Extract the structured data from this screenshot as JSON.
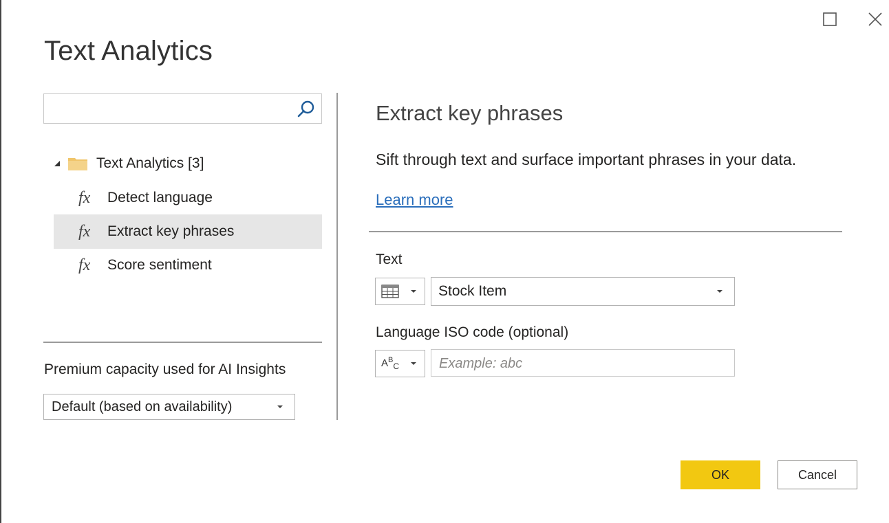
{
  "dialog": {
    "title": "Text Analytics"
  },
  "window_controls": {
    "maximize_icon": "maximize-icon",
    "close_icon": "close-icon"
  },
  "search": {
    "value": "",
    "placeholder": "",
    "icon": "search-icon"
  },
  "tree": {
    "root_label": "Text Analytics [3]",
    "root_expanded": true,
    "items": [
      {
        "label": "Detect language",
        "icon": "fx-icon",
        "selected": false
      },
      {
        "label": "Extract key phrases",
        "icon": "fx-icon",
        "selected": true
      },
      {
        "label": "Score sentiment",
        "icon": "fx-icon",
        "selected": false
      }
    ]
  },
  "premium": {
    "label": "Premium capacity used for AI Insights",
    "selected": "Default (based on availability)"
  },
  "function": {
    "title": "Extract key phrases",
    "description": "Sift through text and surface important phrases in your data.",
    "learn_more": "Learn more"
  },
  "params": [
    {
      "label": "Text",
      "type_icon": "table-column-icon",
      "value": "Stock Item",
      "kind": "select"
    },
    {
      "label": "Language ISO code (optional)",
      "type_icon": "text-type-icon",
      "type_glyph": "ABC",
      "value": "",
      "placeholder": "Example: abc",
      "kind": "input"
    }
  ],
  "buttons": {
    "ok": "OK",
    "cancel": "Cancel"
  },
  "colors": {
    "accent_button": "#f2c811",
    "link": "#2a6ebb",
    "selected_row": "#e6e6e6",
    "folder": "#f0c56a"
  }
}
